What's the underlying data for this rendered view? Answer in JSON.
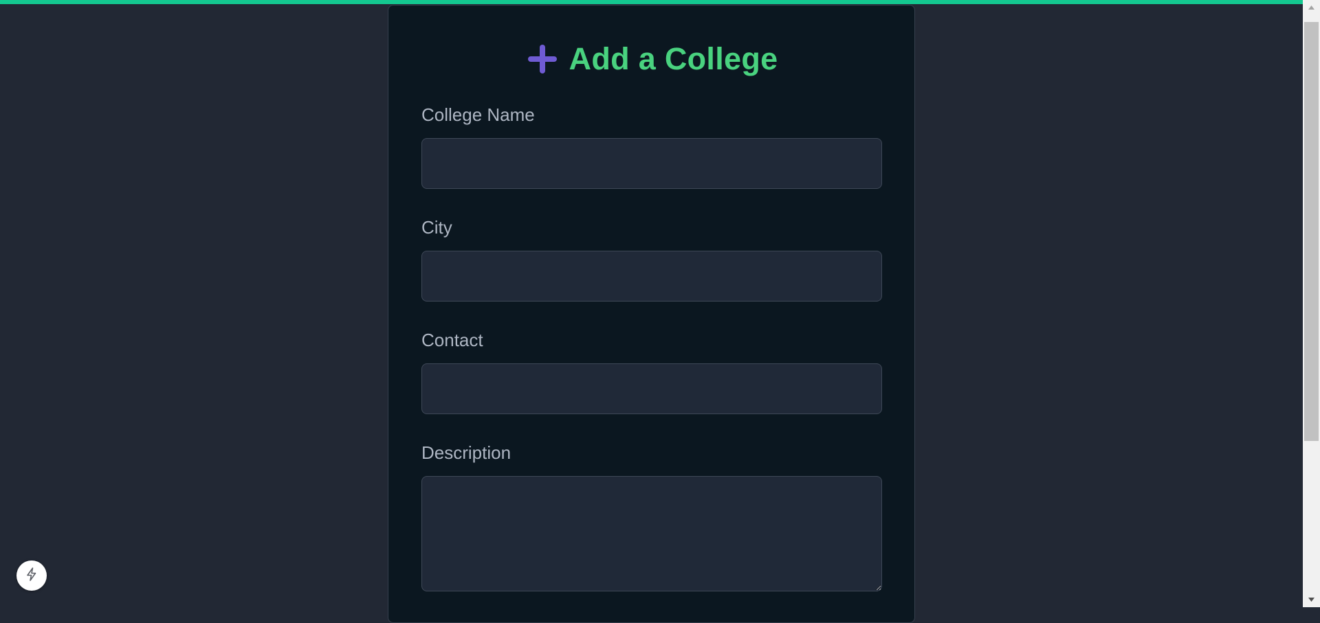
{
  "form": {
    "title": "Add a College",
    "fields": [
      {
        "label": "College Name",
        "value": "",
        "type": "text"
      },
      {
        "label": "City",
        "value": "",
        "type": "text"
      },
      {
        "label": "Contact",
        "value": "",
        "type": "text"
      },
      {
        "label": "Description",
        "value": "",
        "type": "textarea"
      }
    ]
  },
  "icons": {
    "title_icon": "plus-icon",
    "fab_icon": "lightning-bolt-icon"
  },
  "colors": {
    "accent_bar": "#14c890",
    "title": "#49d27f",
    "plus_icon": "#6f5bd3",
    "card_background": "#0b1720",
    "page_background": "#222834",
    "input_background": "#202938"
  }
}
